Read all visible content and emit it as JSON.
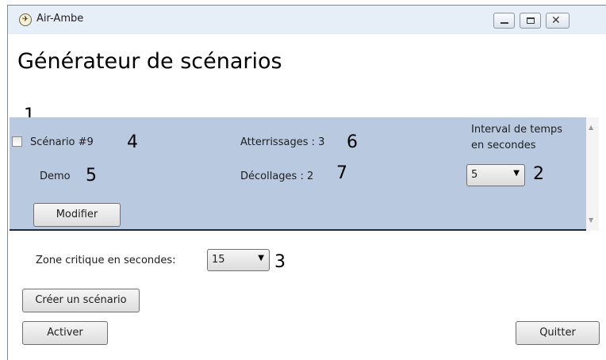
{
  "window": {
    "title": "Air-Ambe",
    "icon": "app-logo-icon"
  },
  "page": {
    "header": "Générateur de scénarios"
  },
  "annotations": [
    "1",
    "2",
    "3",
    "4",
    "5",
    "6",
    "7"
  ],
  "scenario": {
    "name": "Scénario #9",
    "description": "Demo",
    "landings": "Atterrissages : 3",
    "takeoffs": "Décollages : 2",
    "interval_label_line1": "Interval de temps",
    "interval_label_line2": "en secondes",
    "interval_value": "5",
    "modify_button": "Modifier",
    "checked": false
  },
  "critical_zone": {
    "label": "Zone critique en secondes:",
    "value": "15"
  },
  "buttons": {
    "create": "Créer un scénario",
    "activate": "Activer",
    "quit": "Quitter"
  },
  "colors": {
    "panel_bg": "#b8c9e0",
    "titlebar_bg": "#e6eef8"
  }
}
